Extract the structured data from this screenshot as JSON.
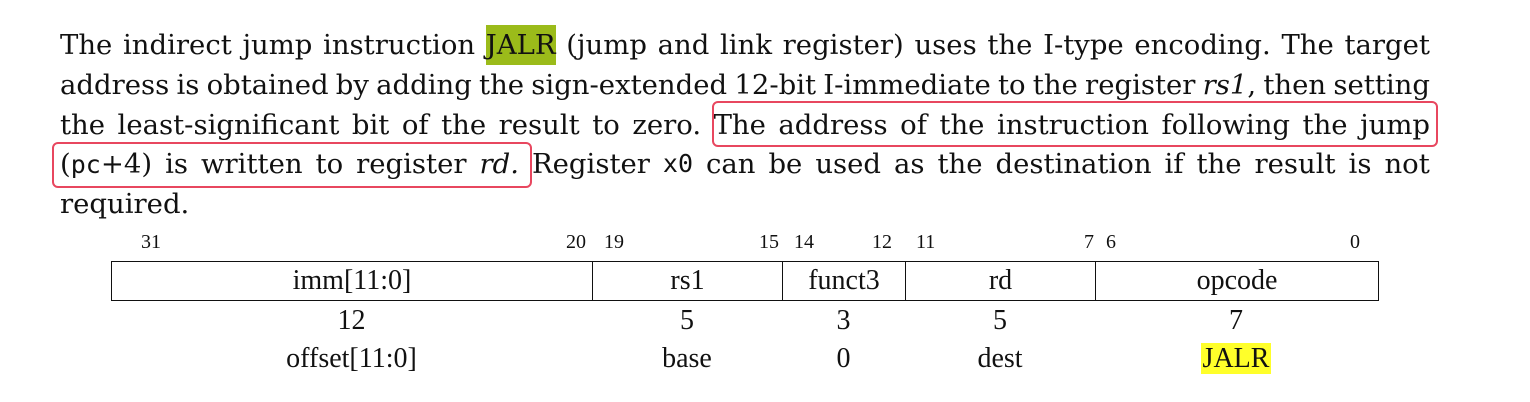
{
  "paragraph": {
    "l1": {
      "w": [
        "The",
        "indirect",
        "jump",
        "instruction"
      ],
      "jalr": "JALR",
      "w2": [
        "(jump",
        "and",
        "link",
        "register)",
        "uses",
        "the",
        "I-type",
        "encoding.",
        "The",
        "target"
      ]
    },
    "l2": {
      "w": [
        "address",
        "is",
        "obtained",
        "by",
        "adding",
        "the",
        "sign-extended",
        "12-bit",
        "I-immediate",
        "to",
        "the",
        "register"
      ],
      "rs1": "rs1",
      "w2": [
        ",",
        "then",
        "setting"
      ]
    },
    "l3": {
      "w": [
        "the",
        "least-significant",
        "bit",
        "of",
        "the",
        "result",
        "to",
        "zero."
      ],
      "w2": [
        "The",
        "address",
        "of",
        "the",
        "instruction",
        "following",
        "the",
        "jump"
      ]
    },
    "l4": {
      "pc_open": "(",
      "pc_code": "pc",
      "pc_rest": "+4)",
      "w": [
        "is",
        "written",
        "to",
        "register"
      ],
      "rd": "rd.",
      "w2": [
        "Register"
      ],
      "x0": "x0",
      "w3": [
        "can",
        "be",
        "used",
        "as",
        "the",
        "destination",
        "if",
        "the",
        "result",
        "is",
        "not"
      ]
    },
    "l5": "required."
  },
  "bit_numbers": [
    "31",
    "20",
    "19",
    "15",
    "14",
    "12",
    "11",
    "7",
    "6",
    "0"
  ],
  "fields": [
    {
      "name": "imm[11:0]",
      "width": "12",
      "role": "offset[11:0]"
    },
    {
      "name": "rs1",
      "width": "5",
      "role": "base"
    },
    {
      "name": "funct3",
      "width": "3",
      "role": "0"
    },
    {
      "name": "rd",
      "width": "5",
      "role": "dest"
    },
    {
      "name": "opcode",
      "width": "7",
      "role": "JALR"
    }
  ],
  "colors": {
    "highlight_green": "#9bbb1a",
    "highlight_yellow": "#ffff2a",
    "annotation_box": "#e8475f"
  }
}
